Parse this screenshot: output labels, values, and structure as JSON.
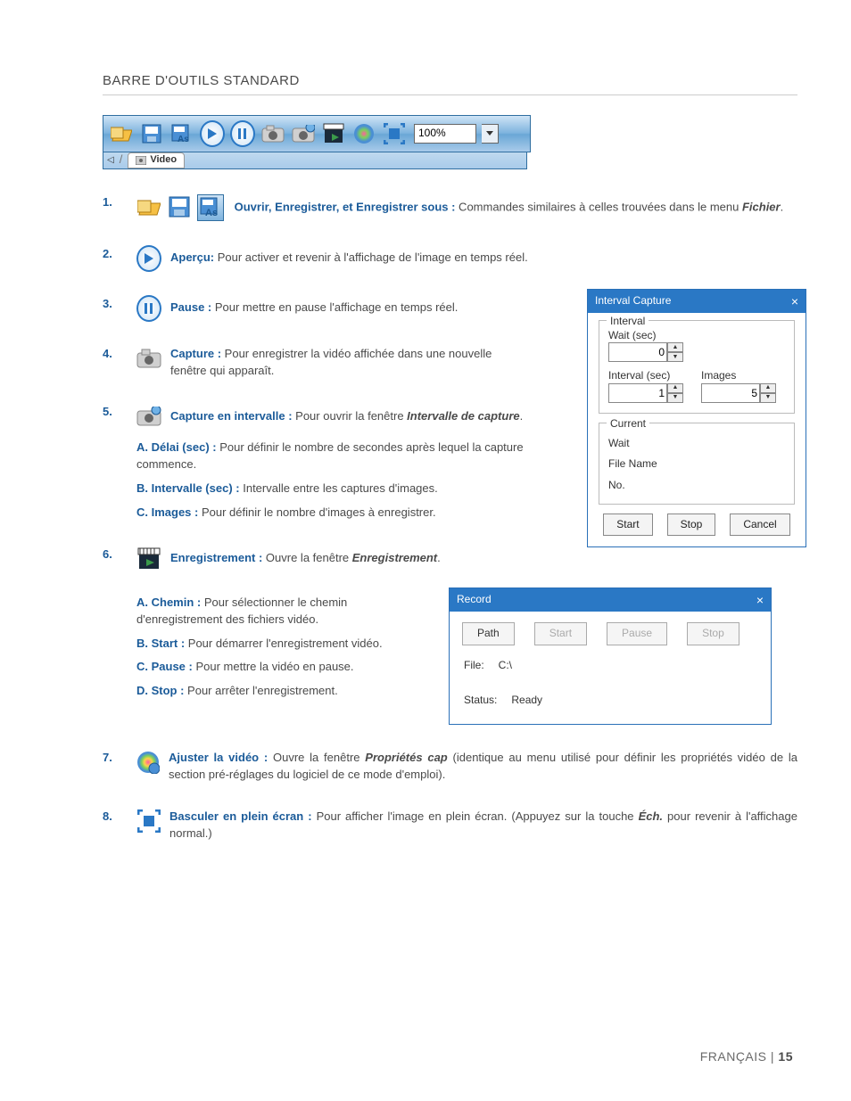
{
  "heading": "BARRE D'OUTILS STANDARD",
  "toolbar": {
    "zoom": "100%",
    "tab": "Video"
  },
  "items": [
    {
      "num": "1.",
      "lead": "Ouvrir, Enregistrer, et Enregistrer sous :",
      "body": " Commandes similaires à celles trouvées dans le menu ",
      "bold_tail": "Fichier",
      "tail": "."
    },
    {
      "num": "2.",
      "lead": "Aperçu:",
      "body": "  Pour activer et revenir à l'affichage de l'image en temps réel."
    },
    {
      "num": "3.",
      "lead": "Pause :",
      "body": " Pour mettre en pause l'affichage en temps réel."
    },
    {
      "num": "4.",
      "lead": "Capture :",
      "body": " Pour enregistrer la vidéo affichée dans une nouvelle fenêtre qui apparaît."
    },
    {
      "num": "5.",
      "lead": "Capture en intervalle :",
      "body": " Pour ouvrir la fenêtre ",
      "bold_tail": "Intervalle de capture",
      "tail": ".",
      "subs": [
        {
          "lead": "A.  Délai (sec) :",
          "body": " Pour définir le nombre de secondes après lequel la capture commence."
        },
        {
          "lead": "B.  Intervalle (sec) :",
          "body": " Intervalle entre les captures d'images."
        },
        {
          "lead": "C.  Images :",
          "body": " Pour définir le nombre d'images à enregistrer."
        }
      ]
    },
    {
      "num": "6.",
      "lead": "Enregistrement :",
      "body": " Ouvre la fenêtre ",
      "bold_tail": "Enregistrement",
      "tail": ".",
      "subs": [
        {
          "lead": "A.  Chemin :",
          "body": " Pour sélectionner le chemin d'enregistrement des fichiers vidéo."
        },
        {
          "lead": "B.  Start :",
          "body": " Pour démarrer l'enregistrement vidéo."
        },
        {
          "lead": "C.  Pause :",
          "body": " Pour mettre la vidéo en pause."
        },
        {
          "lead": "D.  Stop :",
          "body": " Pour arrêter l'enregistrement."
        }
      ]
    },
    {
      "num": "7.",
      "lead": "Ajuster la vidéo :",
      "body": " Ouvre la fenêtre ",
      "bold_tail": "Propriétés cap",
      "tail": " (identique au menu utilisé pour définir les propriétés vidéo de la section pré-réglages du logiciel de ce mode d'emploi)."
    },
    {
      "num": "8.",
      "lead": "Basculer en plein écran :",
      "body": " Pour afficher l'image en plein écran. (Appuyez sur la touche ",
      "bold_tail": "Éch.",
      "tail": " pour revenir à l'affichage normal.)"
    }
  ],
  "interval_dialog": {
    "title": "Interval Capture",
    "group_interval": "Interval",
    "wait_label": "Wait (sec)",
    "wait_value": "0",
    "interval_label": "Interval (sec)",
    "interval_value": "1",
    "images_label": "Images",
    "images_value": "5",
    "group_current": "Current",
    "current_wait": "Wait",
    "current_filename": "File Name",
    "current_no": "No.",
    "start": "Start",
    "stop": "Stop",
    "cancel": "Cancel"
  },
  "record_dialog": {
    "title": "Record",
    "path": "Path",
    "start": "Start",
    "pause": "Pause",
    "stop": "Stop",
    "file_label": "File:",
    "file_value": "C:\\",
    "status_label": "Status:",
    "status_value": "Ready"
  },
  "footer": {
    "lang": "FRANÇAIS",
    "sep": " | ",
    "page": "15"
  }
}
